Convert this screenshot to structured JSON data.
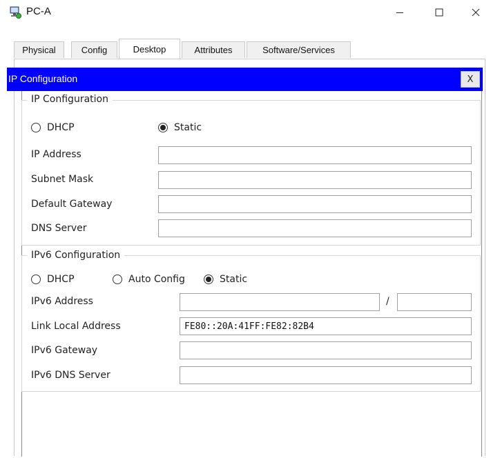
{
  "window": {
    "title": "PC-A",
    "icon": "pc-app-icon",
    "controls": {
      "minimize": "—",
      "maximize": "☐",
      "close": "✕"
    }
  },
  "tabs": [
    {
      "label": "Physical",
      "active": false
    },
    {
      "label": "Config",
      "active": false
    },
    {
      "label": "Desktop",
      "active": true
    },
    {
      "label": "Attributes",
      "active": false
    },
    {
      "label": "Software/Services",
      "active": false
    }
  ],
  "ip_panel": {
    "header": "IP Configuration",
    "close_label": "X",
    "header_color": "#0000ff"
  },
  "ipv4": {
    "group_title": "IP Configuration",
    "mode_options": [
      {
        "label": "DHCP",
        "selected": false
      },
      {
        "label": "Static",
        "selected": true
      }
    ],
    "fields": [
      {
        "label": "IP Address",
        "value": ""
      },
      {
        "label": "Subnet Mask",
        "value": ""
      },
      {
        "label": "Default Gateway",
        "value": ""
      },
      {
        "label": "DNS Server",
        "value": ""
      }
    ]
  },
  "ipv6": {
    "group_title": "IPv6 Configuration",
    "mode_options": [
      {
        "label": "DHCP",
        "selected": false
      },
      {
        "label": "Auto Config",
        "selected": false
      },
      {
        "label": "Static",
        "selected": true
      }
    ],
    "address_label": "IPv6 Address",
    "address_value": "",
    "prefix_separator": "/",
    "prefix_value": "",
    "link_local_label": "Link Local Address",
    "link_local_value": "FE80::20A:41FF:FE82:82B4",
    "gateway_label": "IPv6 Gateway",
    "gateway_value": "",
    "dns_label": "IPv6 DNS Server",
    "dns_value": ""
  }
}
